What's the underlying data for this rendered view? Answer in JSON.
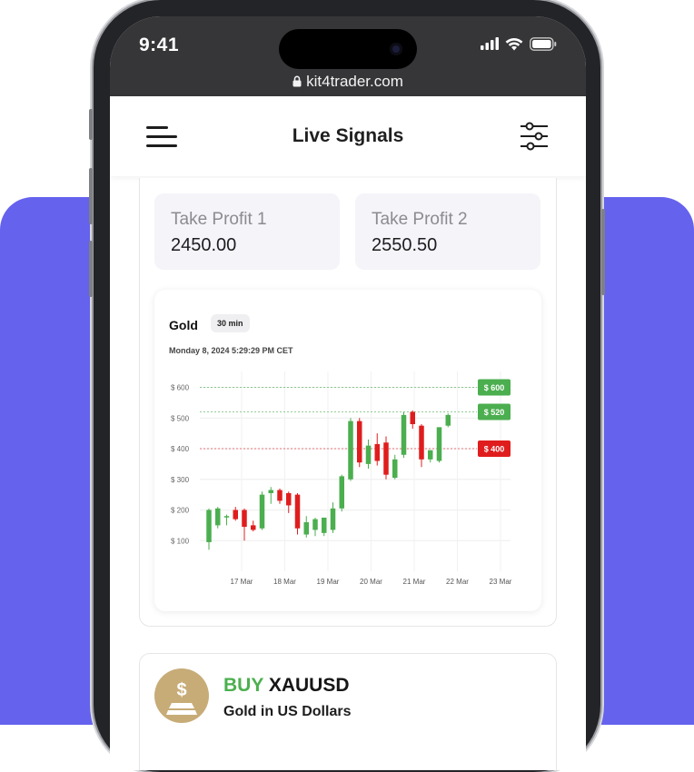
{
  "status_bar": {
    "time": "9:41",
    "url": "kit4trader.com"
  },
  "app_bar": {
    "title": "Live Signals"
  },
  "take_profits": [
    {
      "label": "Take Profit 1",
      "value": "2450.00"
    },
    {
      "label": "Take Profit 2",
      "value": "2550.50"
    }
  ],
  "chart_card": {
    "title": "Gold",
    "interval": "30 min",
    "date": "Monday 8, 2024 5:29:29 PM CET"
  },
  "chart_data": {
    "type": "candlestick",
    "x_ticks": [
      "17 Mar",
      "18 Mar",
      "19 Mar",
      "20 Mar",
      "21 Mar",
      "22 Mar",
      "23 Mar"
    ],
    "y_ticks": [
      "$ 100",
      "$ 200",
      "$ 300",
      "$ 400",
      "$ 500",
      "$ 600"
    ],
    "ylim": [
      0,
      640
    ],
    "grid": true,
    "levels": [
      {
        "label": "$ 600",
        "value": 600,
        "color": "#4bae4f"
      },
      {
        "label": "$ 520",
        "value": 520,
        "color": "#4bae4f"
      },
      {
        "label": "$ 400",
        "value": 400,
        "color": "#e01d1d"
      }
    ],
    "up_color": "#4bae4f",
    "down_color": "#e01d1d",
    "candles": [
      {
        "o": 95,
        "h": 205,
        "l": 70,
        "c": 200
      },
      {
        "o": 150,
        "h": 210,
        "l": 140,
        "c": 205
      },
      {
        "o": 180,
        "h": 185,
        "l": 150,
        "c": 180
      },
      {
        "o": 200,
        "h": 210,
        "l": 165,
        "c": 170
      },
      {
        "o": 200,
        "h": 205,
        "l": 100,
        "c": 145
      },
      {
        "o": 150,
        "h": 165,
        "l": 130,
        "c": 135
      },
      {
        "o": 140,
        "h": 260,
        "l": 135,
        "c": 250
      },
      {
        "o": 255,
        "h": 275,
        "l": 220,
        "c": 265
      },
      {
        "o": 265,
        "h": 270,
        "l": 220,
        "c": 230
      },
      {
        "o": 255,
        "h": 260,
        "l": 190,
        "c": 215
      },
      {
        "o": 250,
        "h": 255,
        "l": 120,
        "c": 140
      },
      {
        "o": 120,
        "h": 180,
        "l": 110,
        "c": 160
      },
      {
        "o": 135,
        "h": 175,
        "l": 115,
        "c": 170
      },
      {
        "o": 125,
        "h": 175,
        "l": 115,
        "c": 175
      },
      {
        "o": 135,
        "h": 225,
        "l": 125,
        "c": 205
      },
      {
        "o": 205,
        "h": 315,
        "l": 195,
        "c": 310
      },
      {
        "o": 300,
        "h": 500,
        "l": 295,
        "c": 490
      },
      {
        "o": 490,
        "h": 500,
        "l": 340,
        "c": 355
      },
      {
        "o": 350,
        "h": 430,
        "l": 335,
        "c": 410
      },
      {
        "o": 415,
        "h": 450,
        "l": 345,
        "c": 360
      },
      {
        "o": 420,
        "h": 440,
        "l": 300,
        "c": 315
      },
      {
        "o": 305,
        "h": 380,
        "l": 300,
        "c": 365
      },
      {
        "o": 380,
        "h": 520,
        "l": 370,
        "c": 510
      },
      {
        "o": 520,
        "h": 525,
        "l": 465,
        "c": 480
      },
      {
        "o": 475,
        "h": 480,
        "l": 340,
        "c": 365
      },
      {
        "o": 365,
        "h": 395,
        "l": 355,
        "c": 395
      },
      {
        "o": 360,
        "h": 470,
        "l": 355,
        "c": 470
      },
      {
        "o": 475,
        "h": 515,
        "l": 470,
        "c": 510
      }
    ]
  },
  "signal": {
    "action": "BUY",
    "pair": "XAUUSD",
    "description": "Gold in US Dollars",
    "icon": "gold-coin-icon",
    "action_color": "#4bb04f"
  },
  "theme": {
    "background_accent": "#6562ee",
    "status_bar_color": "#363638"
  }
}
